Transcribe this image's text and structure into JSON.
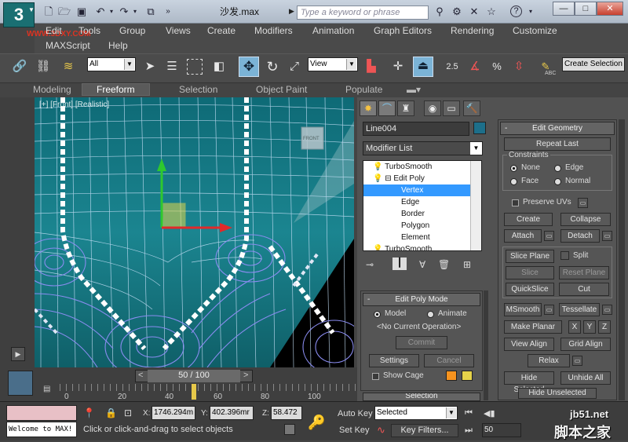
{
  "titlebar": {
    "title": "沙发.max",
    "search_placeholder": "Type a keyword or phrase",
    "logo": "3"
  },
  "menu": {
    "items": [
      "Edit",
      "Tools",
      "Group",
      "Views",
      "Create",
      "Modifiers",
      "Animation",
      "Graph Editors",
      "Rendering",
      "Customize"
    ],
    "items_row2": [
      "MAXScript",
      "Help"
    ],
    "watermark": "WWW.3DXY.COM"
  },
  "toolbar": {
    "filter_value": "All",
    "refcoord_value": "View",
    "create_selection": "Create Selection",
    "snap_label": "2.5",
    "percent_snap": "%",
    "abc": "ABC"
  },
  "ribbon": {
    "tabs": [
      "Modeling",
      "Freeform",
      "Selection",
      "Object Paint",
      "Populate"
    ],
    "active": "Freeform"
  },
  "viewport": {
    "label": "[+] [Front] [Realistic]",
    "viewcube_label": "FRONT"
  },
  "cmdpanel": {
    "object_name": "Line004",
    "object_color": "#1d6f8a",
    "modifier_list": "Modifier List",
    "stack": [
      "TurboSmooth",
      "Edit Poly",
      "Vertex",
      "Edge",
      "Border",
      "Polygon",
      "Element",
      "TurboSmooth"
    ],
    "stack_selected": "Vertex",
    "edit_poly_mode": {
      "title": "Edit Poly Mode",
      "model": "Model",
      "animate": "Animate",
      "no_op": "<No Current Operation>",
      "commit": "Commit",
      "settings": "Settings",
      "cancel": "Cancel",
      "show_cage": "Show Cage"
    },
    "selection_title": "Selection",
    "edit_geometry": {
      "title": "Edit Geometry",
      "repeat_last": "Repeat Last",
      "constraints": "Constraints",
      "none": "None",
      "edge": "Edge",
      "face": "Face",
      "normal": "Normal",
      "preserve_uvs": "Preserve UVs",
      "create": "Create",
      "collapse": "Collapse",
      "attach": "Attach",
      "detach": "Detach",
      "slice_plane": "Slice Plane",
      "split": "Split",
      "slice": "Slice",
      "reset_plane": "Reset Plane",
      "quickslice": "QuickSlice",
      "cut": "Cut",
      "msmooth": "MSmooth",
      "tessellate": "Tessellate",
      "make_planar": "Make Planar",
      "x": "X",
      "y": "Y",
      "z": "Z",
      "view_align": "View Align",
      "grid_align": "Grid Align",
      "relax": "Relax",
      "hide_selected": "Hide Selected",
      "unhide_all": "Unhide All",
      "hide_unselected": "Hide Unselected"
    }
  },
  "timeline": {
    "frame": "50 / 100",
    "ticks": [
      "0",
      "20",
      "40",
      "60",
      "80",
      "100"
    ],
    "prev": "<",
    "next": ">"
  },
  "status": {
    "listener": "Welcome to MAX!",
    "prompt": "Click or click-and-drag to select objects",
    "x_label": "X:",
    "x": "1746.294m",
    "y_label": "Y:",
    "y": "402.396mr",
    "z_label": "Z:",
    "z": "58.472",
    "auto_key": "Auto Key",
    "set_key": "Set Key",
    "selected": "Selected",
    "key_filters": "Key Filters...",
    "frame_value": "50"
  },
  "site_watermark": {
    "url": "jb51.net",
    "name": "脚本之家"
  }
}
